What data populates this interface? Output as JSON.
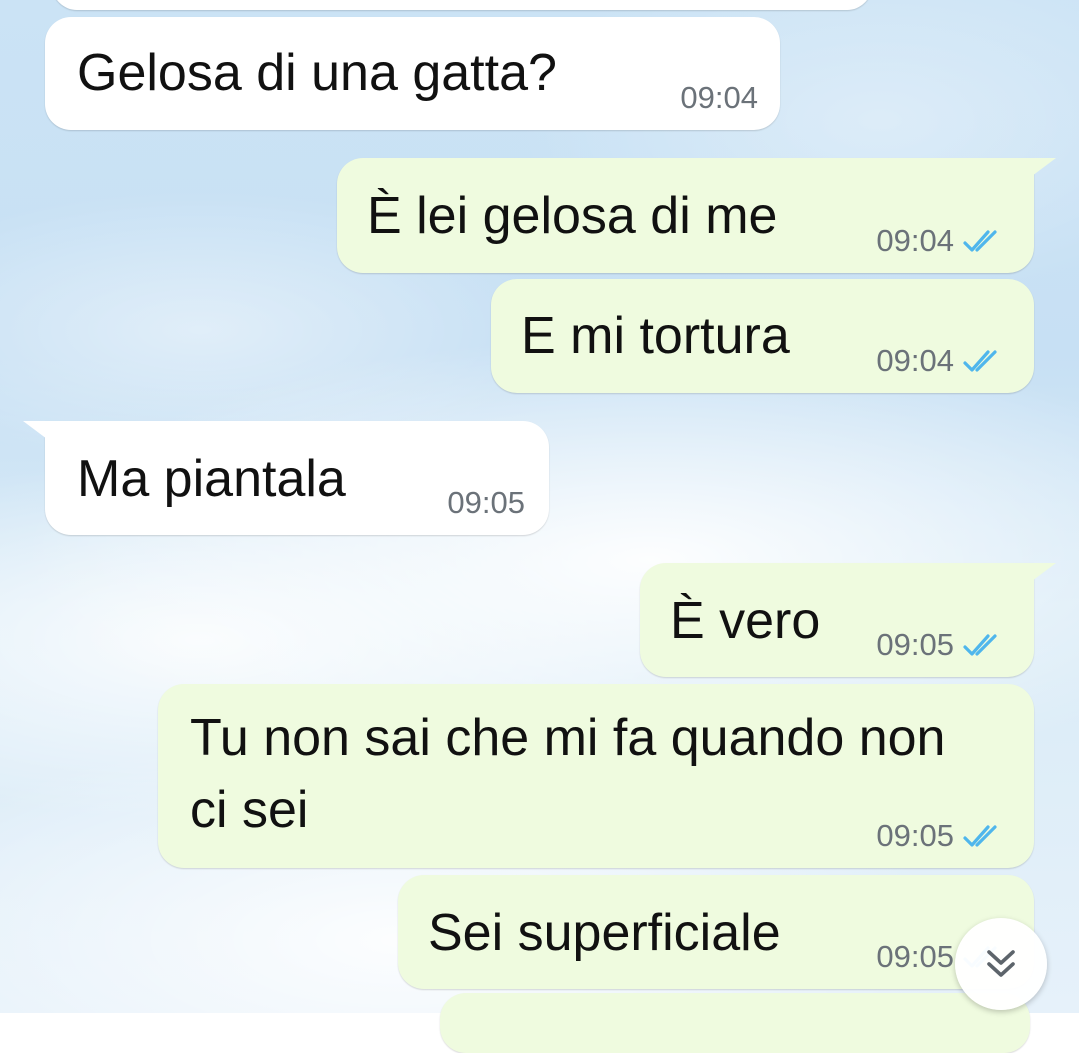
{
  "theme": {
    "incoming_bubble": "#ffffff",
    "outgoing_bubble": "#effbdf",
    "read_tick_color": "#4fb6ec",
    "timestamp_color": "#6b7279"
  },
  "messages": [
    {
      "direction": "in",
      "text": "Gelosa di una gatta?",
      "time": "09:04"
    },
    {
      "direction": "out",
      "text": "È lei gelosa di me",
      "time": "09:04",
      "status": "read"
    },
    {
      "direction": "out",
      "text": "E mi tortura",
      "time": "09:04",
      "status": "read"
    },
    {
      "direction": "in",
      "text": "Ma piantala",
      "time": "09:05"
    },
    {
      "direction": "out",
      "text": "È vero",
      "time": "09:05",
      "status": "read"
    },
    {
      "direction": "out",
      "text": "Tu non sai che mi fa quando non ci sei",
      "time": "09:05",
      "status": "read"
    },
    {
      "direction": "out",
      "text": "Sei superficiale",
      "time": "09:05",
      "status": "read"
    }
  ],
  "scroll_button": {
    "icon": "double-chevron-down-icon"
  }
}
